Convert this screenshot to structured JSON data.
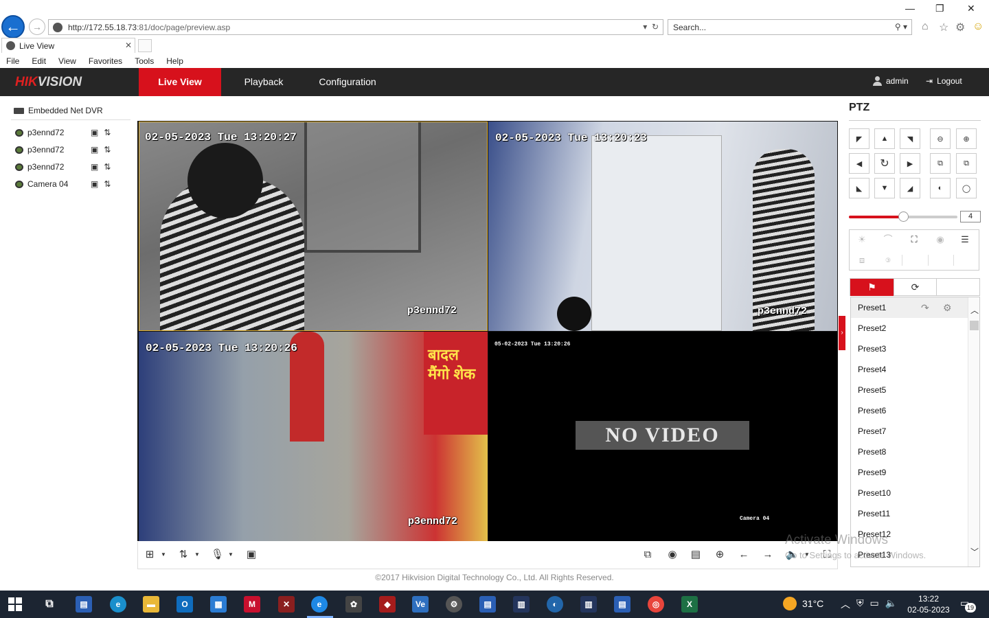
{
  "browser": {
    "url_host": "http://172.55.18.73",
    "url_rest": ":81/doc/page/preview.asp",
    "search_placeholder": "Search...",
    "tab_title": "Live View",
    "menu": [
      "File",
      "Edit",
      "View",
      "Favorites",
      "Tools",
      "Help"
    ]
  },
  "app": {
    "logo_red": "HIK",
    "logo_white": "VISION",
    "nav": {
      "live": "Live View",
      "playback": "Playback",
      "config": "Configuration"
    },
    "user": "admin",
    "logout": "Logout",
    "accent": "#d7111c"
  },
  "tree": {
    "root": "Embedded Net DVR",
    "cameras": [
      {
        "label": "p3ennd72"
      },
      {
        "label": "p3ennd72"
      },
      {
        "label": "p3ennd72"
      },
      {
        "label": "Camera 04"
      }
    ]
  },
  "video": {
    "tiles": [
      {
        "time": "02-05-2023 Tue 13:20:27",
        "name": "p3ennd72"
      },
      {
        "time": "02-05-2023 Tue 13:20:23",
        "name": "p3ennd72"
      },
      {
        "time": "02-05-2023 Tue 13:20:26",
        "name": "p3ennd72"
      },
      {
        "time": "05-02-2023 Tue 13:20:26",
        "name": "Camera 04",
        "status": "NO VIDEO"
      }
    ],
    "sign_text": "बादल मैंगो शेक"
  },
  "footer": "©2017 Hikvision Digital Technology Co., Ltd. All Rights Reserved.",
  "ptz": {
    "title": "PTZ",
    "speed": "4",
    "speed_fraction": 0.5,
    "presets": [
      "Preset1",
      "Preset2",
      "Preset3",
      "Preset4",
      "Preset5",
      "Preset6",
      "Preset7",
      "Preset8",
      "Preset9",
      "Preset10",
      "Preset11",
      "Preset12",
      "Preset13"
    ]
  },
  "watermark": {
    "line1": "Activate Windows",
    "line2": "Go to Settings to activate Windows."
  },
  "taskbar": {
    "weather": "31°C",
    "time": "13:22",
    "date": "02-05-2023",
    "notifications": "19"
  }
}
